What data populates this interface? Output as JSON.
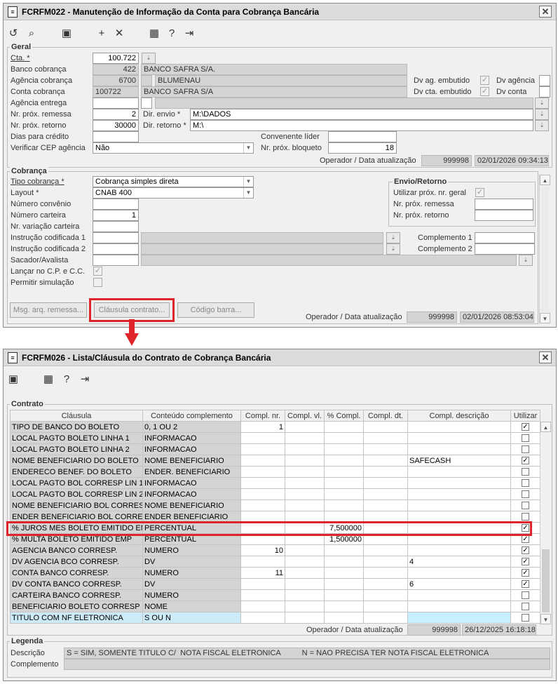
{
  "win1": {
    "title": "FCRFM022 - Manutenção de Informação da Conta para Cobrança Bancária",
    "close": "✕",
    "toolbar": [
      "undo-icon",
      "search-icon",
      "save-icon",
      "add-icon",
      "delete-icon",
      "calendar-icon",
      "help-icon",
      "exit-icon"
    ],
    "geral": {
      "legend": "Geral",
      "cta_label": "Cta. *",
      "cta": "100.722",
      "banco_label": "Banco cobrança",
      "banco_code": "422",
      "banco_name": "BANCO SAFRA S/A.",
      "agencia_label": "Agência cobrança",
      "agencia_code": "6700",
      "agencia_name": "BLUMENAU",
      "dv_ag_emb_label": "Dv ag. embutido",
      "dv_agencia_label": "Dv agência",
      "conta_label": "Conta cobrança",
      "conta_code": "100722",
      "conta_name": "BANCO SAFRA S/A",
      "dv_cta_emb_label": "Dv cta. embutido",
      "dv_conta_label": "Dv conta",
      "ag_entrega_label": "Agência entrega",
      "prox_remessa_label": "Nr. próx. remessa",
      "prox_remessa": "2",
      "dir_envio_label": "Dir. envio *",
      "dir_envio": "M:\\DADOS",
      "prox_retorno_label": "Nr. próx. retorno",
      "prox_retorno": "30000",
      "dir_retorno_label": "Dir. retorno *",
      "dir_retorno": "M:\\",
      "dias_credito_label": "Dias para crédito",
      "convenente_label": "Convenente líder",
      "verif_cep_label": "Verificar CEP agência",
      "verif_cep": "Não",
      "prox_bloqueto_label": "Nr. próx. bloqueto",
      "prox_bloqueto": "18",
      "op_label": "Operador / Data atualização",
      "op_user": "999998",
      "op_date": "02/01/2026 09:34:13"
    },
    "cobranca": {
      "legend": "Cobrança",
      "tipo_label": "Tipo cobrança *",
      "tipo": "Cobrança simples direta",
      "layout_label": "Layout *",
      "layout": "CNAB 400",
      "num_conv_label": "Número convênio",
      "num_carteira_label": "Número carteira",
      "num_carteira": "1",
      "var_carteira_label": "Nr. variação carteira",
      "instr1_label": "Instrução codificada 1",
      "instr2_label": "Instrução codificada 2",
      "sacador_label": "Sacador/Avalista",
      "lancar_label": "Lançar no C.P. e C.C.",
      "permitir_label": "Permitir simulação",
      "compl1_label": "Complemento 1",
      "compl2_label": "Complemento 2",
      "env_legend": "Envio/Retorno",
      "util_prox_label": "Utilizar próx. nr. geral",
      "env_remessa_label": "Nr. próx. remessa",
      "env_retorno_label": "Nr. próx. retorno",
      "btn_msg": "Msg. arq. remessa...",
      "btn_clausula": "Cláusula contrato...",
      "btn_codigo": "Código barra...",
      "op_label": "Operador / Data atualização",
      "op_user": "999998",
      "op_date": "02/01/2026 08:53:04"
    }
  },
  "win2": {
    "title": "FCRFM026 - Lista/Cláusula do Contrato de Cobrança Bancária",
    "close": "✕",
    "toolbar": [
      "save-icon",
      "calendar-icon",
      "help-icon",
      "exit-icon"
    ],
    "contrato_legend": "Contrato",
    "headers": [
      "Cláusula",
      "Conteúdo complemento",
      "Compl. nr.",
      "Compl. vl.",
      "% Compl.",
      "Compl. dt.",
      "Compl. descrição",
      "Utilizar"
    ],
    "rows": [
      {
        "clausula": "TIPO DE BANCO DO BOLETO",
        "conteudo": "0, 1 OU 2",
        "nr": "1",
        "vl": "",
        "pct": "",
        "dt": "",
        "desc": "",
        "use": true
      },
      {
        "clausula": "LOCAL PAGTO BOLETO LINHA 1",
        "conteudo": "INFORMACAO",
        "nr": "",
        "vl": "",
        "pct": "",
        "dt": "",
        "desc": "",
        "use": false
      },
      {
        "clausula": "LOCAL PAGTO BOLETO LINHA 2",
        "conteudo": "INFORMACAO",
        "nr": "",
        "vl": "",
        "pct": "",
        "dt": "",
        "desc": "",
        "use": false
      },
      {
        "clausula": "NOME BENEFICIARIO DO BOLETO",
        "conteudo": "NOME BENEFICIARIO",
        "nr": "",
        "vl": "",
        "pct": "",
        "dt": "",
        "desc": "SAFECASH",
        "use": true
      },
      {
        "clausula": "ENDERECO BENEF. DO BOLETO",
        "conteudo": "ENDER. BENEFICIARIO",
        "nr": "",
        "vl": "",
        "pct": "",
        "dt": "",
        "desc": "",
        "use": false
      },
      {
        "clausula": "LOCAL PAGTO BOL CORRESP LIN 1",
        "conteudo": "INFORMACAO",
        "nr": "",
        "vl": "",
        "pct": "",
        "dt": "",
        "desc": "",
        "use": false
      },
      {
        "clausula": "LOCAL PAGTO BOL CORRESP LIN 2",
        "conteudo": "INFORMACAO",
        "nr": "",
        "vl": "",
        "pct": "",
        "dt": "",
        "desc": "",
        "use": false
      },
      {
        "clausula": "NOME BENEFICIARIO BOL CORRESP",
        "conteudo": "NOME BENEFICIARIO",
        "nr": "",
        "vl": "",
        "pct": "",
        "dt": "",
        "desc": "",
        "use": false
      },
      {
        "clausula": "ENDER BENEFICIARIO BOL CORRESP",
        "conteudo": "ENDER BENEFICIARIO",
        "nr": "",
        "vl": "",
        "pct": "",
        "dt": "",
        "desc": "",
        "use": false
      },
      {
        "clausula": "% JUROS MES BOLETO EMITIDO EMP",
        "conteudo": "PERCENTUAL",
        "nr": "",
        "vl": "",
        "pct": "7,500000",
        "dt": "",
        "desc": "",
        "use": true
      },
      {
        "clausula": "% MULTA BOLETO EMITIDO EMP",
        "conteudo": "PERCENTUAL",
        "nr": "",
        "vl": "",
        "pct": "1,500000",
        "dt": "",
        "desc": "",
        "use": true
      },
      {
        "clausula": "AGENCIA BANCO CORRESP.",
        "conteudo": "NUMERO",
        "nr": "10",
        "vl": "",
        "pct": "",
        "dt": "",
        "desc": "",
        "use": true
      },
      {
        "clausula": "DV AGENCIA BCO CORRESP.",
        "conteudo": "DV",
        "nr": "",
        "vl": "",
        "pct": "",
        "dt": "",
        "desc": "4",
        "use": true
      },
      {
        "clausula": "CONTA BANCO CORRESP.",
        "conteudo": "NUMERO",
        "nr": "11",
        "vl": "",
        "pct": "",
        "dt": "",
        "desc": "",
        "use": true
      },
      {
        "clausula": "DV CONTA BANCO CORRESP.",
        "conteudo": "DV",
        "nr": "",
        "vl": "",
        "pct": "",
        "dt": "",
        "desc": "6",
        "use": true
      },
      {
        "clausula": "CARTEIRA BANCO CORRESP.",
        "conteudo": "NUMERO",
        "nr": "",
        "vl": "",
        "pct": "",
        "dt": "",
        "desc": "",
        "use": false
      },
      {
        "clausula": "BENEFICIARIO BOLETO CORRESP",
        "conteudo": "NOME",
        "nr": "",
        "vl": "",
        "pct": "",
        "dt": "",
        "desc": "",
        "use": false
      },
      {
        "clausula": "TITULO COM NF ELETRONICA",
        "conteudo": "S OU N",
        "nr": "",
        "vl": "",
        "pct": "",
        "dt": "",
        "desc": "",
        "use": false
      }
    ],
    "op_label": "Operador / Data atualização",
    "op_user": "999998",
    "op_date": "26/12/2025 16:18:18",
    "legenda_legend": "Legenda",
    "desc_label": "Descrição",
    "desc_value": "S = SIM, SOMENTE TITULO C/  NOTA FISCAL ELETRONICA          N = NAO PRECISA TER NOTA FISCAL ELETRONICA",
    "compl_label": "Complemento"
  },
  "colors": {
    "highlight": "#e0242b",
    "readonly": "#d4d4d4",
    "selected_row": "#cdeaf7"
  }
}
